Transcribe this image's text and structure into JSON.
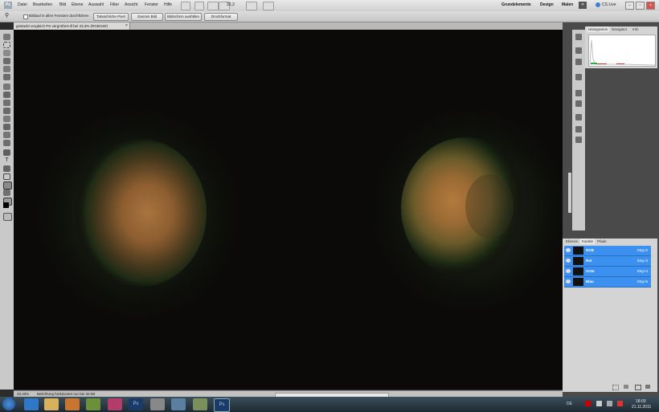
{
  "app": {
    "logo": "Ps"
  },
  "menu": [
    "Datei",
    "Bearbeiten",
    "Bild",
    "Ebene",
    "Auswahl",
    "Filter",
    "Ansicht",
    "Fenster",
    "Hilfe"
  ],
  "menubar_zoom": "33,3",
  "workspaces": [
    "Grundelemente",
    "Design",
    "Malen"
  ],
  "more_label": "»",
  "cslive": "CS Live",
  "options": {
    "checkbox_label": "Bildlauf in allen Fenstern durchführen",
    "buttons": [
      "Tatsächliche Pixel",
      "Ganzes Bild",
      "Bildschirm ausfüllen",
      "Druckformat"
    ]
  },
  "document_tab": "gestackt vergleich PS vergrößert.tif bei 33,3% (RGB/16#)",
  "status": {
    "zoom": "33,33%",
    "message": "Belichtung funktioniert nur bei 32-Bit"
  },
  "panels": {
    "top_tabs": [
      "Histogramm",
      "Navigator",
      "Info"
    ],
    "bottom_tabs": [
      "Ebenen",
      "Kanäle",
      "Pfade"
    ],
    "channels": [
      {
        "name": "RGB",
        "shortcut": "Strg+2"
      },
      {
        "name": "Rot",
        "shortcut": "Strg+3"
      },
      {
        "name": "Grün",
        "shortcut": "Strg+4"
      },
      {
        "name": "Blau",
        "shortcut": "Strg+5"
      }
    ]
  },
  "taskbar": {
    "language": "DE",
    "time": "18:03",
    "date": "21.11.2011"
  }
}
